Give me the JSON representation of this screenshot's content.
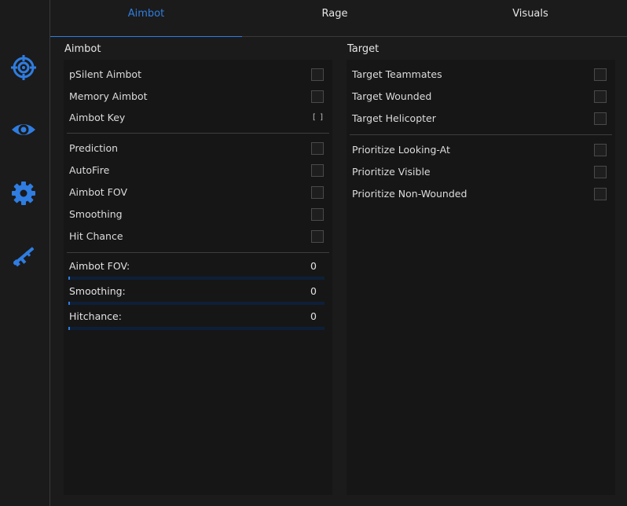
{
  "tabs": [
    "Aimbot",
    "Rage",
    "Visuals"
  ],
  "active_tab": "Aimbot",
  "sidebar": [
    "crosshair-icon",
    "eye-icon",
    "gear-icon",
    "rifle-icon"
  ],
  "accent": "#2f7de1",
  "left": {
    "title": "Aimbot",
    "group1": [
      {
        "label": "pSilent Aimbot",
        "checked": false
      },
      {
        "label": "Memory Aimbot",
        "checked": false
      },
      {
        "label": "Aimbot Key",
        "keybind": "[ ]"
      }
    ],
    "group2": [
      {
        "label": "Prediction",
        "checked": false
      },
      {
        "label": "AutoFire",
        "checked": false
      },
      {
        "label": "Aimbot FOV",
        "checked": false
      },
      {
        "label": "Smoothing",
        "checked": false
      },
      {
        "label": "Hit Chance",
        "checked": false
      }
    ],
    "sliders": [
      {
        "label": "Aimbot FOV:",
        "value": "0",
        "fraction": 0
      },
      {
        "label": "Smoothing:",
        "value": "0",
        "fraction": 0
      },
      {
        "label": "Hitchance:",
        "value": "0",
        "fraction": 0
      }
    ]
  },
  "right": {
    "title": "Target",
    "group1": [
      {
        "label": "Target Teammates",
        "checked": false
      },
      {
        "label": "Target Wounded",
        "checked": false
      },
      {
        "label": "Target Helicopter",
        "checked": false
      }
    ],
    "group2": [
      {
        "label": "Prioritize Looking-At",
        "checked": false
      },
      {
        "label": "Prioritize Visible",
        "checked": false
      },
      {
        "label": "Prioritize Non-Wounded",
        "checked": false
      }
    ]
  }
}
